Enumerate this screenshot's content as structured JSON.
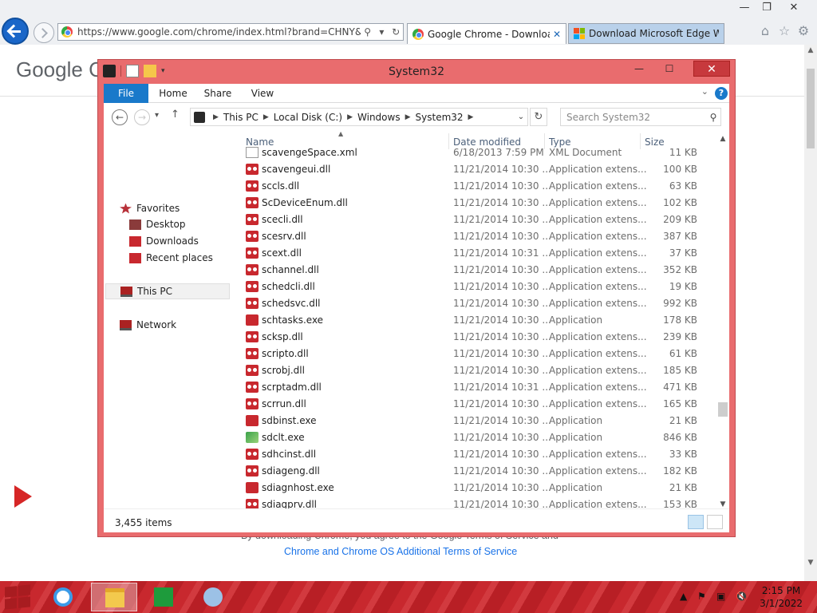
{
  "browser": {
    "url": "https://www.google.com/chrome/index.html?brand=CHNY&utm_",
    "tabs": [
      {
        "label": "Google Chrome - Downloa...",
        "active": true
      },
      {
        "label": "Download Microsoft Edge We...",
        "active": false
      }
    ],
    "window_controls": {
      "minimize": "—",
      "maximize": "❐",
      "close": "✕"
    }
  },
  "page": {
    "logo_text": "Google Ch",
    "terms_line1": "By downloading Chrome, you agree to the Google Terms of Service and",
    "terms_line2": "Chrome and Chrome OS Additional Terms of Service"
  },
  "explorer": {
    "title": "System32",
    "ribbon_tabs": [
      "File",
      "Home",
      "Share",
      "View"
    ],
    "breadcrumb": [
      "This PC",
      "Local Disk (C:)",
      "Windows",
      "System32"
    ],
    "search_placeholder": "Search System32",
    "nav_pane": {
      "favorites": "Favorites",
      "favorites_items": [
        "Desktop",
        "Downloads",
        "Recent places"
      ],
      "this_pc": "This PC",
      "network": "Network"
    },
    "columns": {
      "name": "Name",
      "date": "Date modified",
      "type": "Type",
      "size": "Size"
    },
    "partial_row": {
      "name": "scavengeSpace.xml",
      "date": "6/18/2013 7:59 PM",
      "type": "XML Document",
      "size": "11 KB"
    },
    "rows": [
      {
        "name": "scavengeui.dll",
        "date": "11/21/2014 10:30 ...",
        "type": "Application extens...",
        "size": "100 KB",
        "icon": "dll"
      },
      {
        "name": "sccls.dll",
        "date": "11/21/2014 10:30 ...",
        "type": "Application extens...",
        "size": "63 KB",
        "icon": "dll"
      },
      {
        "name": "ScDeviceEnum.dll",
        "date": "11/21/2014 10:30 ...",
        "type": "Application extens...",
        "size": "102 KB",
        "icon": "dll"
      },
      {
        "name": "scecli.dll",
        "date": "11/21/2014 10:30 ...",
        "type": "Application extens...",
        "size": "209 KB",
        "icon": "dll"
      },
      {
        "name": "scesrv.dll",
        "date": "11/21/2014 10:30 ...",
        "type": "Application extens...",
        "size": "387 KB",
        "icon": "dll"
      },
      {
        "name": "scext.dll",
        "date": "11/21/2014 10:31 ...",
        "type": "Application extens...",
        "size": "37 KB",
        "icon": "dll"
      },
      {
        "name": "schannel.dll",
        "date": "11/21/2014 10:30 ...",
        "type": "Application extens...",
        "size": "352 KB",
        "icon": "dll"
      },
      {
        "name": "schedcli.dll",
        "date": "11/21/2014 10:30 ...",
        "type": "Application extens...",
        "size": "19 KB",
        "icon": "dll"
      },
      {
        "name": "schedsvc.dll",
        "date": "11/21/2014 10:30 ...",
        "type": "Application extens...",
        "size": "992 KB",
        "icon": "dll"
      },
      {
        "name": "schtasks.exe",
        "date": "11/21/2014 10:30 ...",
        "type": "Application",
        "size": "178 KB",
        "icon": "exe"
      },
      {
        "name": "scksp.dll",
        "date": "11/21/2014 10:30 ...",
        "type": "Application extens...",
        "size": "239 KB",
        "icon": "dll"
      },
      {
        "name": "scripto.dll",
        "date": "11/21/2014 10:30 ...",
        "type": "Application extens...",
        "size": "61 KB",
        "icon": "dll"
      },
      {
        "name": "scrobj.dll",
        "date": "11/21/2014 10:30 ...",
        "type": "Application extens...",
        "size": "185 KB",
        "icon": "dll"
      },
      {
        "name": "scrptadm.dll",
        "date": "11/21/2014 10:31 ...",
        "type": "Application extens...",
        "size": "471 KB",
        "icon": "dll"
      },
      {
        "name": "scrrun.dll",
        "date": "11/21/2014 10:30 ...",
        "type": "Application extens...",
        "size": "165 KB",
        "icon": "dll"
      },
      {
        "name": "sdbinst.exe",
        "date": "11/21/2014 10:30 ...",
        "type": "Application",
        "size": "21 KB",
        "icon": "exe"
      },
      {
        "name": "sdclt.exe",
        "date": "11/21/2014 10:30 ...",
        "type": "Application",
        "size": "846 KB",
        "icon": "exe-green"
      },
      {
        "name": "sdhcinst.dll",
        "date": "11/21/2014 10:30 ...",
        "type": "Application extens...",
        "size": "33 KB",
        "icon": "dll"
      },
      {
        "name": "sdiageng.dll",
        "date": "11/21/2014 10:30 ...",
        "type": "Application extens...",
        "size": "182 KB",
        "icon": "dll"
      },
      {
        "name": "sdiagnhost.exe",
        "date": "11/21/2014 10:30 ...",
        "type": "Application",
        "size": "21 KB",
        "icon": "exe"
      },
      {
        "name": "sdiagprv.dll",
        "date": "11/21/2014 10:30 ...",
        "type": "Application extens...",
        "size": "153 KB",
        "icon": "dll"
      }
    ],
    "status_count": "3,455 items"
  },
  "taskbar": {
    "time": "2:15 PM",
    "date": "3/1/2022",
    "accent": "#c8282e"
  }
}
